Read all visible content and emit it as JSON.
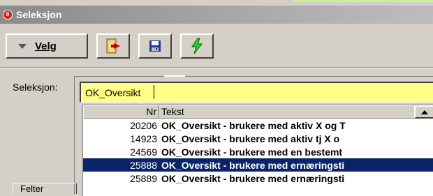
{
  "window": {
    "title": "Seleksjon",
    "icon": "app-logo-icon"
  },
  "toolbar": {
    "velg_label": "Velg",
    "buttons": [
      {
        "icon": "exit-door-icon"
      },
      {
        "icon": "save-disk-icon"
      },
      {
        "icon": "lightning-execute-icon"
      }
    ]
  },
  "selection": {
    "label": "Seleksjon:",
    "value": "OK_Oversikt"
  },
  "dropdown": {
    "columns": [
      "Nr",
      "Tekst"
    ],
    "rows": [
      {
        "nr": "20206",
        "tekst": "OK_Oversikt - brukere med aktiv X og T"
      },
      {
        "nr": "14923",
        "tekst": "OK_Oversikt - brukere med aktiv tj X o"
      },
      {
        "nr": "24569",
        "tekst": "OK_Oversikt - brukere med en bestemt"
      },
      {
        "nr": "25888",
        "tekst": "OK_Oversikt - brukere med ernæringsti",
        "selected": true
      },
      {
        "nr": "25889",
        "tekst": "OK_Oversikt - brukere med ernæringsti"
      }
    ]
  },
  "tab": {
    "label": "Felter"
  },
  "colors": {
    "input_bg": "#ffff88",
    "selected_row": "#0a246a",
    "titlebar": "#a8a8a8"
  }
}
